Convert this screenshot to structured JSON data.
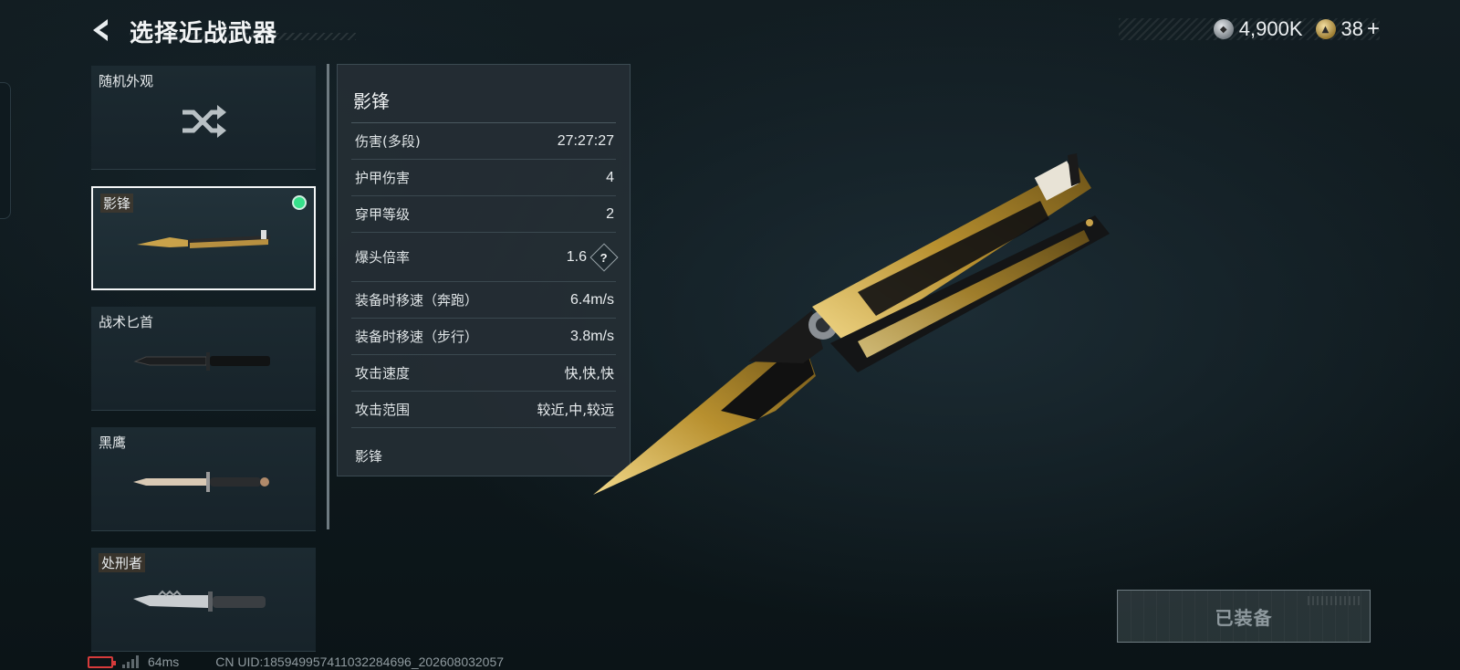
{
  "header": {
    "title": "选择近战武器",
    "back_icon": "chevron-left-icon"
  },
  "currency": {
    "silver": {
      "icon": "silver-coin-icon",
      "value": "4,900K"
    },
    "gold": {
      "icon": "gold-coin-icon",
      "value": "38"
    },
    "add_label": "+"
  },
  "weapons": [
    {
      "label": "随机外观",
      "icon": "shuffle-icon",
      "selected": false,
      "equipped": false
    },
    {
      "label": "影锋",
      "icon": "butterfly-knife-icon",
      "selected": true,
      "equipped": true
    },
    {
      "label": "战术匕首",
      "icon": "tactical-dagger-icon",
      "selected": false,
      "equipped": false
    },
    {
      "label": "黑鹰",
      "icon": "combat-knife-icon",
      "selected": false,
      "equipped": false
    },
    {
      "label": "处刑者",
      "icon": "serrated-knife-icon",
      "selected": false,
      "equipped": false
    }
  ],
  "stats_panel": {
    "title": "影锋",
    "rows": [
      {
        "label": "伤害(多段)",
        "value": "27:27:27"
      },
      {
        "label": "护甲伤害",
        "value": "4"
      },
      {
        "label": "穿甲等级",
        "value": "2"
      },
      {
        "label": "爆头倍率",
        "value": "1.6",
        "help": "?"
      },
      {
        "label": "装备时移速（奔跑）",
        "value": "6.4m/s"
      },
      {
        "label": "装备时移速（步行）",
        "value": "3.8m/s"
      },
      {
        "label": "攻击速度",
        "value": "快,快,快"
      },
      {
        "label": "攻击范围",
        "value": "较近,中,较远"
      }
    ],
    "footer": "影锋"
  },
  "equip_button": {
    "label": "已装备",
    "state": "disabled"
  },
  "status_bar": {
    "ping": "64ms",
    "uid": "CN UID:185949957411032284696_202608032057"
  },
  "colors": {
    "accent_equipped": "#36e08a",
    "gold": "#c9a24a",
    "battery_low": "#d63b3b"
  }
}
